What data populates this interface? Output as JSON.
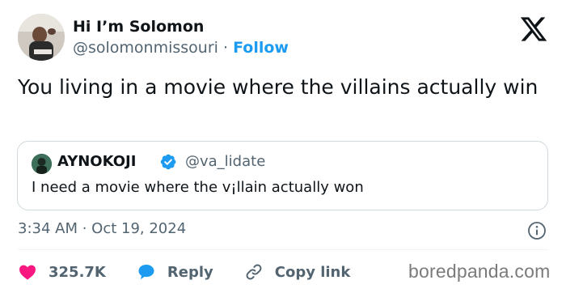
{
  "author": {
    "name": "Hi I’m Solomon",
    "handle": "@solomonmissouri",
    "separator": "·",
    "follow_label": "Follow"
  },
  "tweet": {
    "text": "You living in a movie where the villains actually win"
  },
  "quoted_tweet": {
    "name": "AY⁠NOKOJI",
    "handle": "@va_lidate",
    "text": "I need a movie where the v¡llain actually won"
  },
  "timestamp": "3:34 AM · Oct 19, 2024",
  "actions": {
    "like_count": "325.7K",
    "reply_label": "Reply",
    "copy_link_label": "Copy link"
  },
  "watermark": "boredpanda.com",
  "icons": {
    "x_logo": "x-logo-icon",
    "verified": "verified-badge-icon",
    "info": "info-icon",
    "heart": "heart-icon",
    "reply": "reply-bubble-icon",
    "link": "link-icon"
  },
  "colors": {
    "accent": "#1d9bf0",
    "like": "#f91880",
    "text": "#0f1419",
    "secondary": "#536471",
    "border": "#cfd9de"
  }
}
